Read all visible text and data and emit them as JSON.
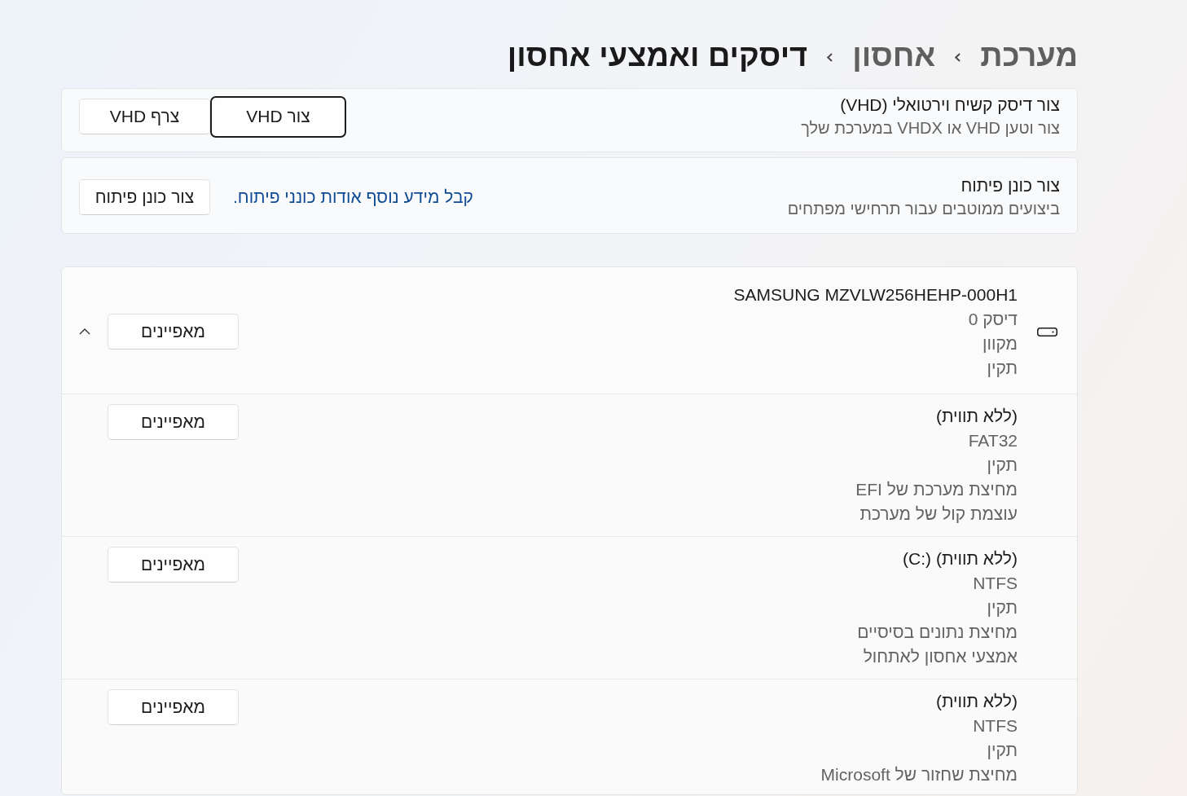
{
  "breadcrumb": [
    {
      "label": "מערכת",
      "current": false
    },
    {
      "label": "אחסון",
      "current": false
    },
    {
      "label": "דיסקים ואמצעי אחסון",
      "current": true
    }
  ],
  "vhd_card": {
    "title": "צור דיסק קשיח וירטואלי (VHD)",
    "subtitle": "צור וטען VHD או VHDX במערכת שלך",
    "buttons": [
      {
        "label": "צור VHD",
        "focused": true
      },
      {
        "label": "צרף VHD",
        "focused": false
      }
    ]
  },
  "dev_drive_card": {
    "title": "צור כונן פיתוח",
    "subtitle": "ביצועים ממוטבים עבור תרחישי מפתחים",
    "link": "קבל מידע נוסף אודות כונני פיתוח.",
    "buttons": [
      {
        "label": "צור כונן פיתוח",
        "focused": false
      }
    ]
  },
  "disk": {
    "name": "SAMSUNG MZVLW256HEHP-000H1",
    "details": [
      "דיסק 0",
      "מקוון",
      "תקין"
    ],
    "button": "מאפיינים",
    "expanded": true,
    "partitions": [
      {
        "label": "(ללא תווית)",
        "details": [
          "FAT32",
          "תקין",
          "מחיצת מערכת של EFI",
          "עוצמת קול של מערכת"
        ],
        "button": "מאפיינים"
      },
      {
        "label": "(ללא תווית)",
        "drive": "(C:)",
        "details": [
          "NTFS",
          "תקין",
          "מחיצת נתונים בסיסיים",
          "אמצעי אחסון לאתחול"
        ],
        "button": "מאפיינים"
      },
      {
        "label": "(ללא תווית)",
        "details": [
          "NTFS",
          "תקין",
          "מחיצת שחזור של Microsoft"
        ],
        "button": "מאפיינים"
      }
    ]
  }
}
